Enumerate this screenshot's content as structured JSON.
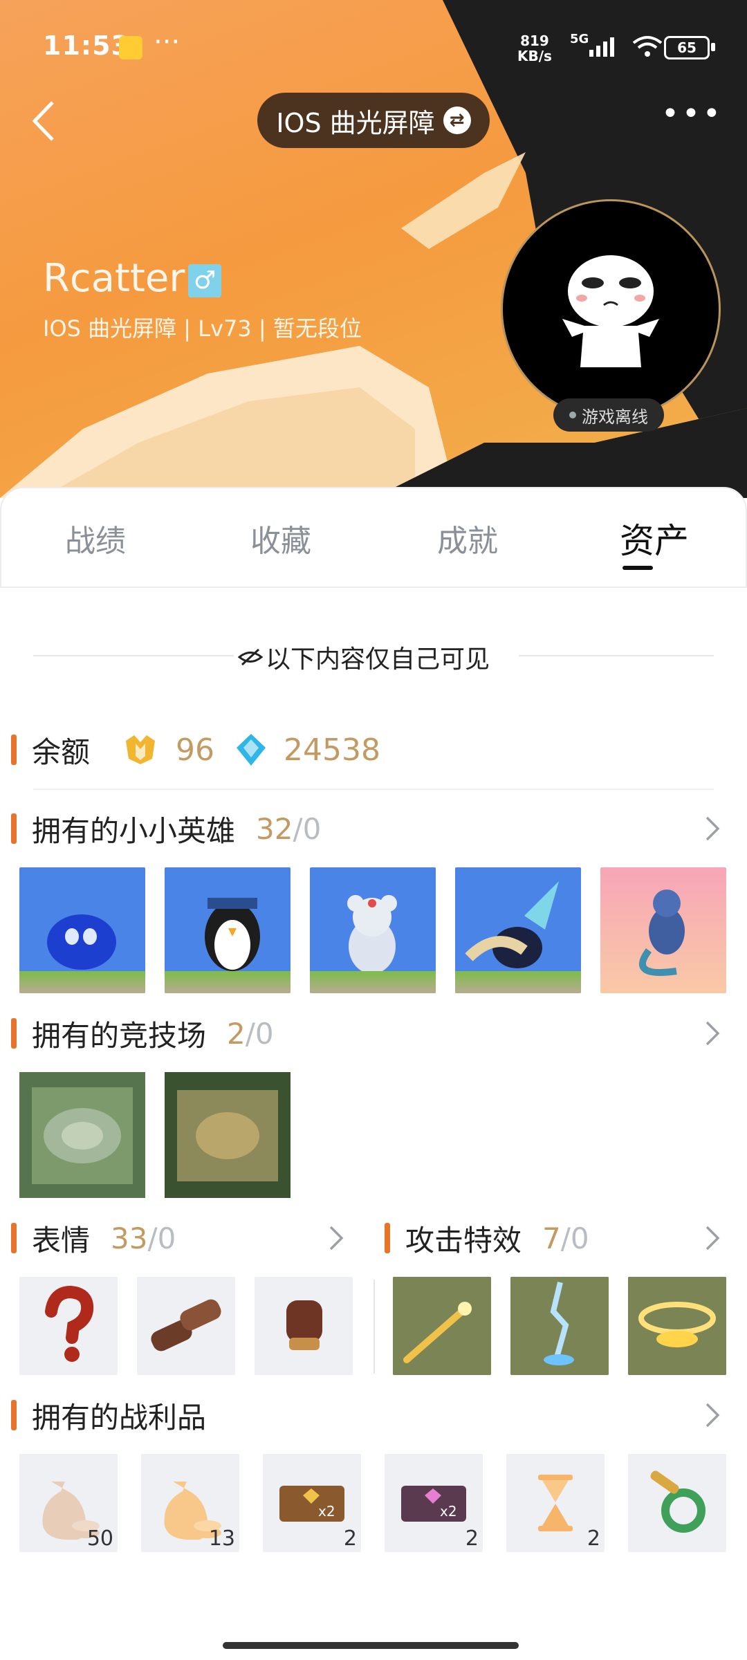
{
  "status_bar": {
    "time": "11:53",
    "net_speed_value": "819",
    "net_speed_unit": "KB/s",
    "network": "5G",
    "battery": "65"
  },
  "header": {
    "server": "IOS 曲光屏障",
    "username": "Rcatter",
    "gender_symbol": "♂",
    "subline": "IOS 曲光屏障 | Lv73 | 暂无段位",
    "presence": "游戏离线"
  },
  "tabs": [
    {
      "label": "战绩"
    },
    {
      "label": "收藏"
    },
    {
      "label": "成就"
    },
    {
      "label": "资产"
    }
  ],
  "privacy_note": "以下内容仅自己可见",
  "balance": {
    "title": "余额",
    "gold": "96",
    "gems": "24538"
  },
  "legends": {
    "title": "拥有的小小英雄",
    "owned": "32",
    "sep_total": "/0"
  },
  "arenas": {
    "title": "拥有的竞技场",
    "owned": "2",
    "sep_total": "/0"
  },
  "emotes": {
    "title": "表情",
    "owned": "33",
    "sep_total": "/0"
  },
  "booms": {
    "title": "攻击特效",
    "owned": "7",
    "sep_total": "/0"
  },
  "loot": {
    "title": "拥有的战利品",
    "counts": [
      "50",
      "13",
      "2",
      "2",
      "2"
    ]
  },
  "colors": {
    "accent": "#e8742c",
    "gold_text": "#c39a62",
    "muted": "#b8bdc3"
  }
}
